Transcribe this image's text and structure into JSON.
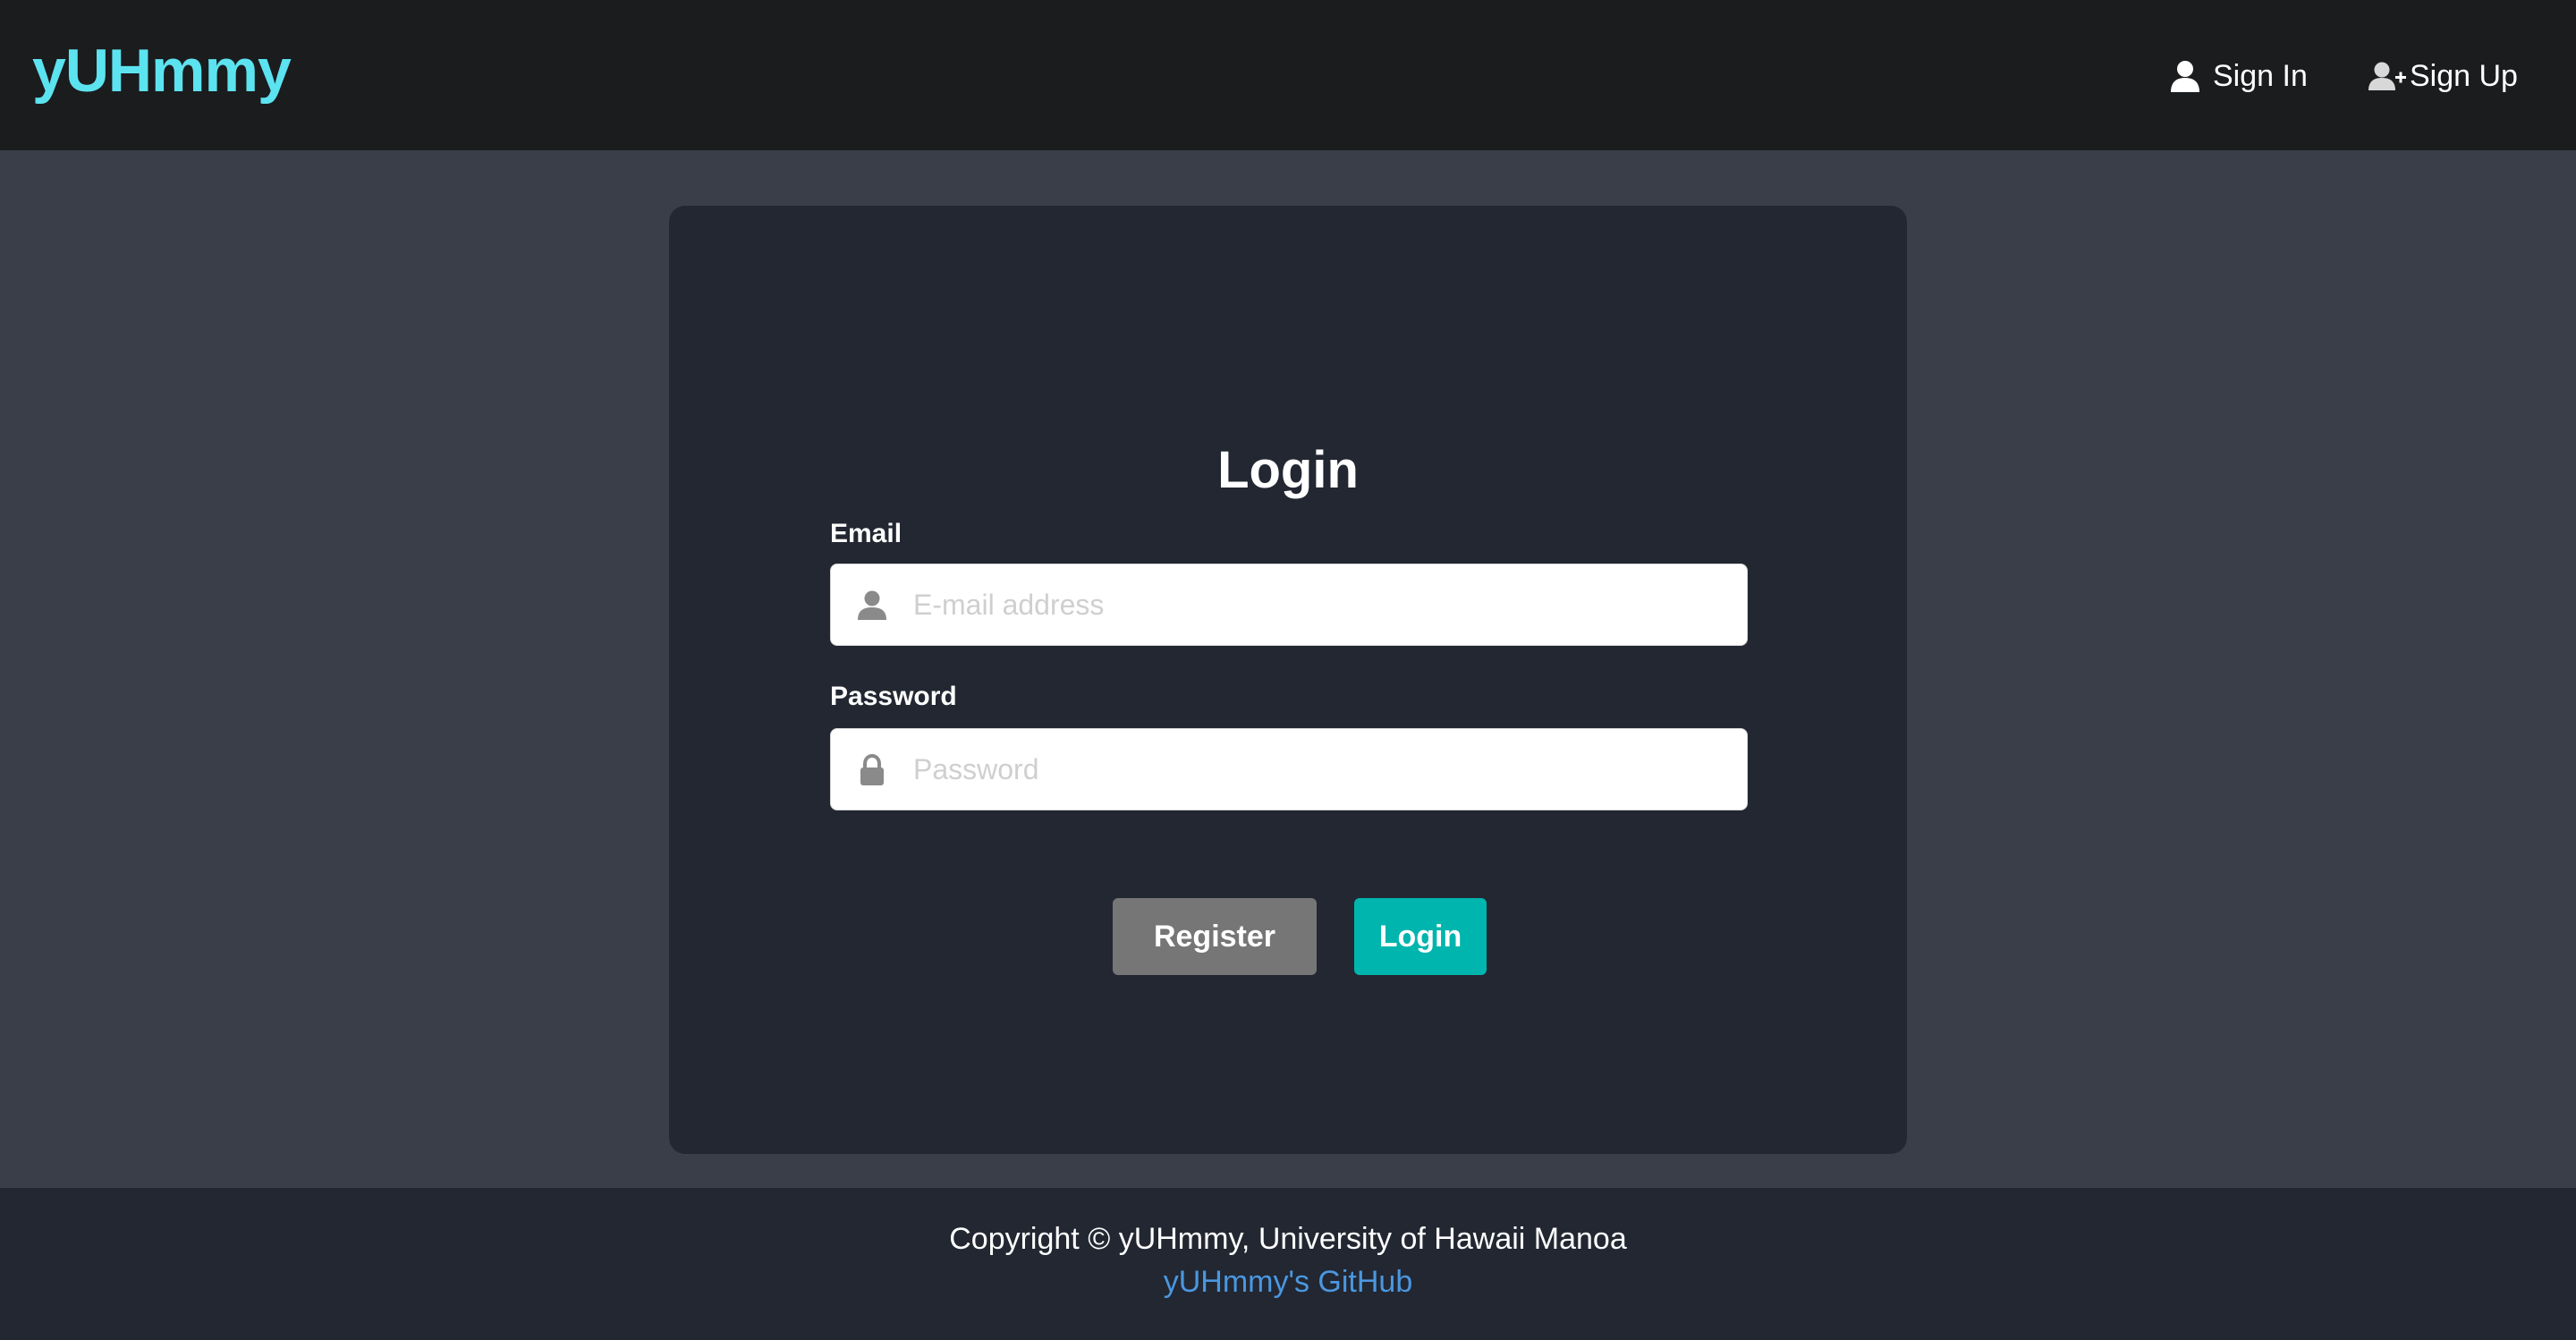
{
  "navbar": {
    "brand": "yUHmmy",
    "links": [
      {
        "label": "Sign In",
        "icon": "user-icon"
      },
      {
        "label": "Sign Up",
        "icon": "add-user-icon"
      }
    ]
  },
  "login": {
    "title": "Login",
    "email": {
      "label": "Email",
      "placeholder": "E-mail address",
      "value": "",
      "icon": "user-icon"
    },
    "password": {
      "label": "Password",
      "placeholder": "Password",
      "value": "",
      "icon": "lock-icon"
    },
    "register_label": "Register",
    "login_label": "Login"
  },
  "footer": {
    "copyright": "Copyright © yUHmmy, University of Hawaii Manoa",
    "github_label": "yUHmmy's GitHub"
  },
  "colors": {
    "brand": "#5ce3f0",
    "navbar_bg": "#1b1c1e",
    "page_bg": "#3a3e48",
    "card_bg": "#222732",
    "register_button": "#767676",
    "login_button": "#00b5ad",
    "link": "#4b97e0"
  }
}
